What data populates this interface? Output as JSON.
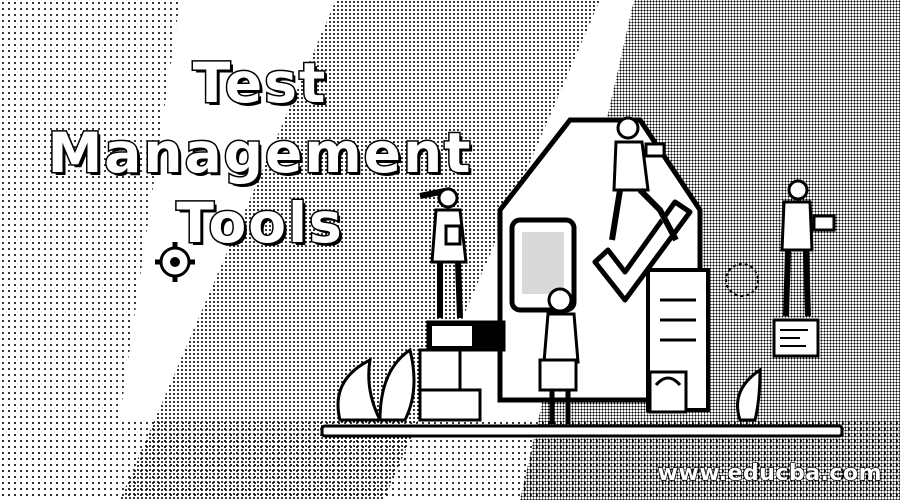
{
  "title": {
    "line1": "Test",
    "line2": "Management",
    "line3": "Tools"
  },
  "watermark": "www.educba.com",
  "colors": {
    "ink": "#000000",
    "paper": "#ffffff"
  },
  "icons": [
    "gear-icon",
    "checkmark-icon",
    "laptop-icon",
    "telescope-icon",
    "cloud-icon",
    "plant-icon"
  ]
}
